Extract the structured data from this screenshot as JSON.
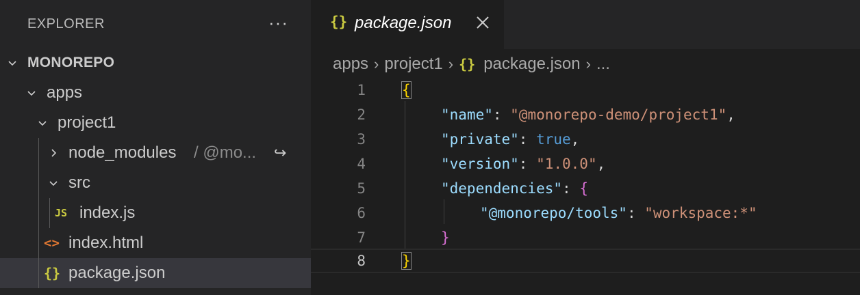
{
  "explorer": {
    "title": "EXPLORER",
    "more_icon": "ellipsis-icon",
    "more_label": "···",
    "tree": [
      {
        "label": "MONOREPO",
        "type": "folder-root",
        "expanded": true
      },
      {
        "label": "apps",
        "type": "folder",
        "expanded": true
      },
      {
        "label": "project1",
        "type": "folder",
        "expanded": true
      },
      {
        "label": "node_modules",
        "suffix": "/ @mo...",
        "type": "symlink-folder",
        "expanded": false
      },
      {
        "label": "src",
        "type": "folder",
        "expanded": true
      },
      {
        "label": "index.js",
        "type": "file",
        "icon_text": "JS"
      },
      {
        "label": "index.html",
        "type": "file",
        "icon_text": "<>"
      },
      {
        "label": "package.json",
        "type": "file",
        "icon_text": "{}",
        "selected": true
      }
    ],
    "link_icon_label": "↪"
  },
  "tabs": [
    {
      "icon_text": "{}",
      "label": "package.json",
      "active": true
    }
  ],
  "breadcrumbs": {
    "items": [
      "apps",
      "project1",
      "package.json",
      "..."
    ],
    "separator": "›",
    "file_icon_text": "{}"
  },
  "editor": {
    "line_numbers": [
      "1",
      "2",
      "3",
      "4",
      "5",
      "6",
      "7",
      "8"
    ],
    "current_line": 8,
    "tokens": {
      "l1_brace": "{",
      "l2_key": "\"name\"",
      "l2_colon": ": ",
      "l2_val": "\"@monorepo-demo/project1\"",
      "l2_comma": ",",
      "l3_key": "\"private\"",
      "l3_colon": ": ",
      "l3_val": "true",
      "l3_comma": ",",
      "l4_key": "\"version\"",
      "l4_colon": ": ",
      "l4_val": "\"1.0.0\"",
      "l4_comma": ",",
      "l5_key": "\"dependencies\"",
      "l5_colon": ": ",
      "l5_brace": "{",
      "l6_key": "\"@monorepo/tools\"",
      "l6_colon": ": ",
      "l6_val": "\"workspace:*\"",
      "l7_brace": "}",
      "l8_brace": "}"
    }
  },
  "colors": {
    "sidebar_bg": "#252526",
    "editor_bg": "#1e1e1e",
    "json_key": "#9cdcfe",
    "json_string": "#ce9178",
    "json_boolean": "#569cd6",
    "bracket_level1": "#ffd700",
    "bracket_level2": "#da70d6",
    "js_icon": "#cbcb41",
    "html_icon": "#e37933"
  }
}
